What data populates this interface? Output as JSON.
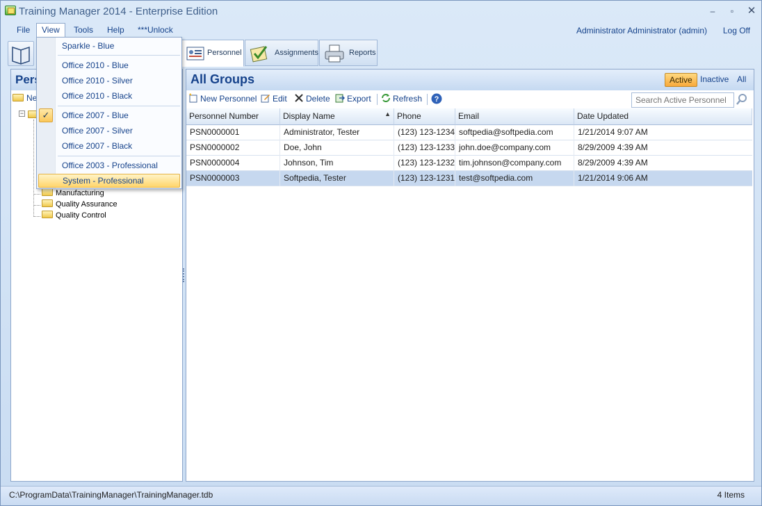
{
  "window": {
    "title": "Training Manager 2014 - Enterprise Edition"
  },
  "menubar": {
    "items": [
      "File",
      "View",
      "Tools",
      "Help",
      "***Unlock Trial mode***"
    ],
    "open_item": "View",
    "user": "Administrator Administrator (admin)",
    "logoff": "Log Off"
  },
  "view_menu": {
    "items": [
      {
        "label": "Sparkle - Blue",
        "checked": false,
        "highlighted": false
      },
      {
        "label": "Office 2010 - Blue",
        "checked": false,
        "highlighted": false
      },
      {
        "label": "Office 2010 - Silver",
        "checked": false,
        "highlighted": false
      },
      {
        "label": "Office 2010 - Black",
        "checked": false,
        "highlighted": false
      },
      {
        "label": "Office 2007 - Blue",
        "checked": true,
        "highlighted": false
      },
      {
        "label": "Office 2007 - Silver",
        "checked": false,
        "highlighted": false
      },
      {
        "label": "Office 2007 - Black",
        "checked": false,
        "highlighted": false
      },
      {
        "label": "Office 2003 - Professional",
        "checked": false,
        "highlighted": false
      },
      {
        "label": "System - Professional",
        "checked": false,
        "highlighted": true
      }
    ],
    "check_glyph": "✓"
  },
  "tabs": [
    {
      "label": "Personnel",
      "icon": "personnel-card-icon",
      "active": true
    },
    {
      "label": "Assignments",
      "icon": "assignments-check-icon",
      "active": false
    },
    {
      "label": "Reports",
      "icon": "printer-icon",
      "active": false
    }
  ],
  "left_panel": {
    "header": "Pers",
    "new_label": "Ne",
    "tree_visible_items": [
      "Manufacturing",
      "Quality Assurance",
      "Quality Control"
    ]
  },
  "right_panel": {
    "title": "All Groups",
    "filters": [
      {
        "label": "Active",
        "active": true
      },
      {
        "label": "Inactive",
        "active": false
      },
      {
        "label": "All",
        "active": false
      }
    ],
    "toolbar": {
      "new": "New Personnel",
      "edit": "Edit",
      "delete": "Delete",
      "export": "Export",
      "refresh": "Refresh"
    },
    "search_placeholder": "Search Active Personnel",
    "columns": [
      "Personnel Number",
      "Display Name",
      "Phone",
      "Email",
      "Date Updated"
    ],
    "sorted_column": "Display Name",
    "rows": [
      {
        "number": "PSN0000001",
        "name": "Administrator, Tester",
        "phone": "(123) 123-1234",
        "email": "softpedia@softpedia.com",
        "updated": "1/21/2014 9:07 AM",
        "selected": false
      },
      {
        "number": "PSN0000002",
        "name": "Doe, John",
        "phone": "(123) 123-1233",
        "email": "john.doe@company.com",
        "updated": "8/29/2009 4:39 AM",
        "selected": false
      },
      {
        "number": "PSN0000004",
        "name": "Johnson, Tim",
        "phone": "(123) 123-1232",
        "email": "tim.johnson@company.com",
        "updated": "8/29/2009 4:39 AM",
        "selected": false
      },
      {
        "number": "PSN0000003",
        "name": "Softpedia, Tester",
        "phone": "(123) 123-1231",
        "email": "test@softpedia.com",
        "updated": "1/21/2014 9:06 AM",
        "selected": true
      }
    ]
  },
  "statusbar": {
    "path": "C:\\ProgramData\\TrainingManager\\TrainingManager.tdb",
    "count": "4 Items"
  },
  "colors": {
    "accent": "#15428b",
    "selected_row": "#c6d8ef",
    "active_filter": "#f8a93b"
  }
}
